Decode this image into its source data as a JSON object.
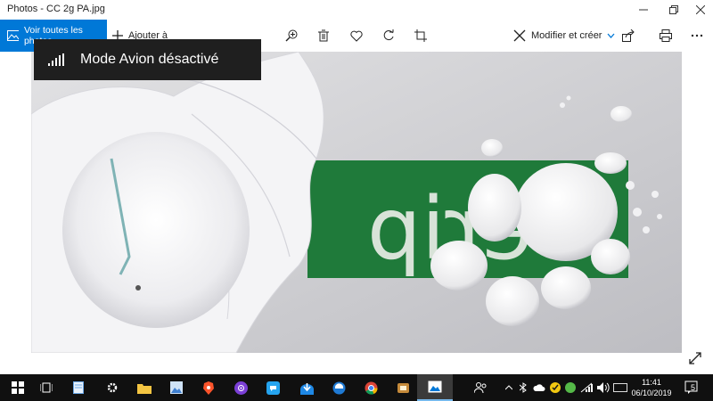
{
  "window": {
    "title": "Photos - CC 2g PA.jpg"
  },
  "toolbar": {
    "view_all_label": "Voir toutes les photos",
    "add_to_label": "Ajouter à",
    "edit_create_label": "Modifier et créer"
  },
  "toast": {
    "message": "Mode Avion désactivé"
  },
  "photo": {
    "sign_text": "erip"
  },
  "taskbar": {
    "time": "11:41",
    "date": "06/10/2019",
    "notification_count": "5"
  },
  "colors": {
    "accent": "#0078d7",
    "taskbar": "#101010",
    "toast": "#1f1f1f",
    "sign_green": "#1f7a3a"
  }
}
